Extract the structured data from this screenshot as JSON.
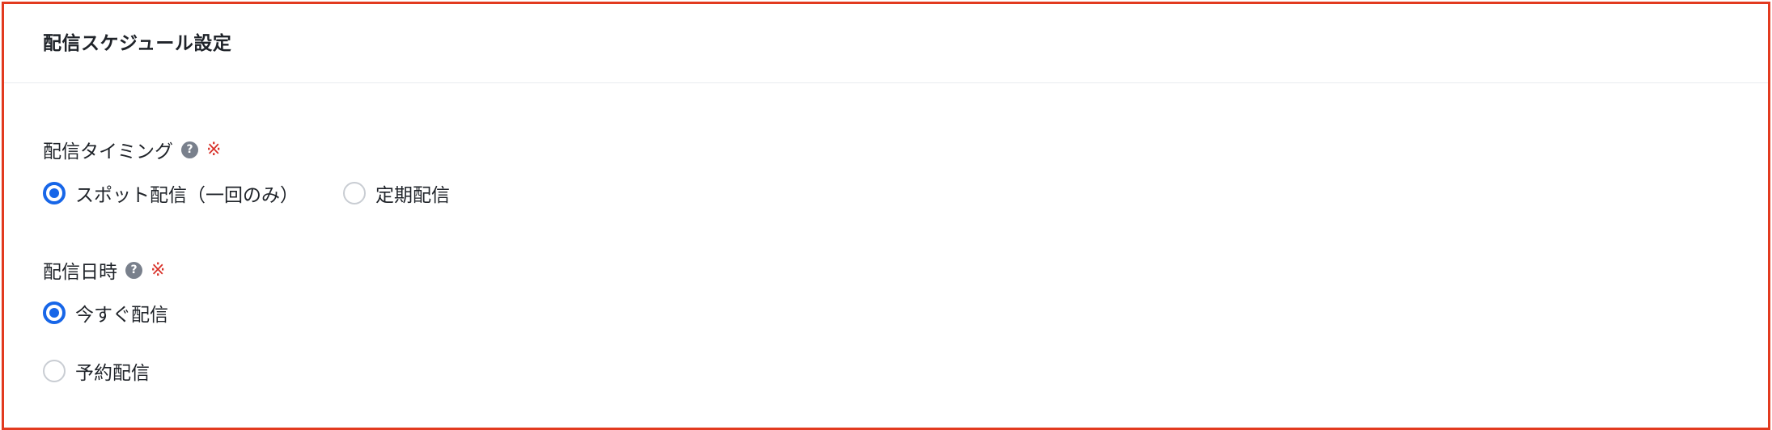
{
  "section": {
    "title": "配信スケジュール設定"
  },
  "delivery_timing": {
    "label": "配信タイミング",
    "required_mark": "※",
    "options": [
      {
        "label": "スポット配信（一回のみ）",
        "selected": true
      },
      {
        "label": "定期配信",
        "selected": false
      }
    ]
  },
  "delivery_datetime": {
    "label": "配信日時",
    "required_mark": "※",
    "options": [
      {
        "label": "今すぐ配信",
        "selected": true
      },
      {
        "label": "予約配信",
        "selected": false
      }
    ]
  },
  "colors": {
    "accent": "#1766e8",
    "required": "#d8322a",
    "panel_border": "#e23a1f",
    "help_icon": "#79808c"
  }
}
